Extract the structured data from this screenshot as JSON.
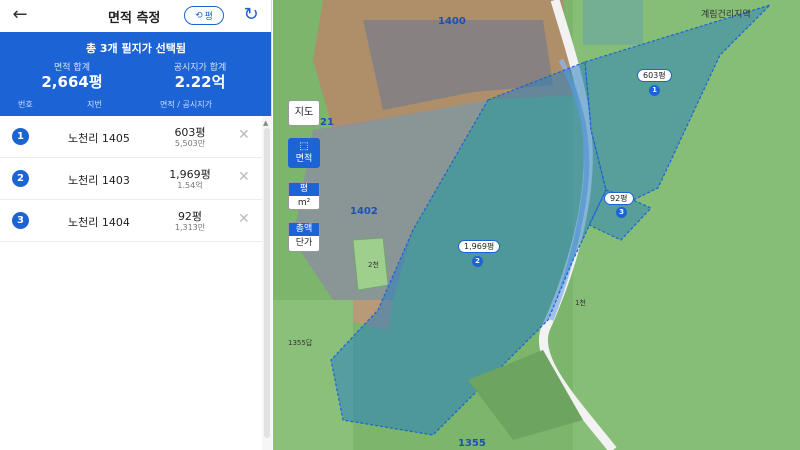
{
  "header": {
    "title": "면적 측정",
    "back_icon": "back-arrow-icon",
    "unit_toggle_label": "평",
    "unit_toggle_icon": "swap-icon",
    "reset_icon": "reset-icon"
  },
  "summary": {
    "title": "총 3개 필지가 선택됨",
    "area_label": "면적 합계",
    "area_value": "2,664평",
    "price_label": "공시지가 합계",
    "price_value": "2.22억",
    "columns": {
      "no": "번호",
      "lot": "지번",
      "area_price": "면적 / 공시지가"
    }
  },
  "parcels": [
    {
      "no": "1",
      "lot": "노천리 1405",
      "area": "603평",
      "price": "5,503만"
    },
    {
      "no": "2",
      "lot": "노천리 1403",
      "area": "1,969평",
      "price": "1.54억"
    },
    {
      "no": "3",
      "lot": "노천리 1404",
      "area": "92평",
      "price": "1,313만"
    }
  ],
  "map": {
    "controls": {
      "map_label": "지도",
      "area_label": "면적",
      "unit_top": "평",
      "unit_bottom": "m²",
      "total_top": "총액",
      "total_bottom": "단가"
    },
    "village_label": "계림건리지역",
    "lot_labels": {
      "l1400": "1400",
      "l1402": "1402",
      "l1355": "1355",
      "l21": "21"
    },
    "small_labels": {
      "s1355": "1355답",
      "s2": "2천",
      "s1": "1천"
    },
    "pins": [
      {
        "no": "1",
        "area": "603평"
      },
      {
        "no": "2",
        "area": "1,969평"
      },
      {
        "no": "3",
        "area": "92평"
      }
    ]
  },
  "colors": {
    "accent": "#1c63d6",
    "selection_fill": "#2a7fc0",
    "forest": "#7fb871"
  }
}
